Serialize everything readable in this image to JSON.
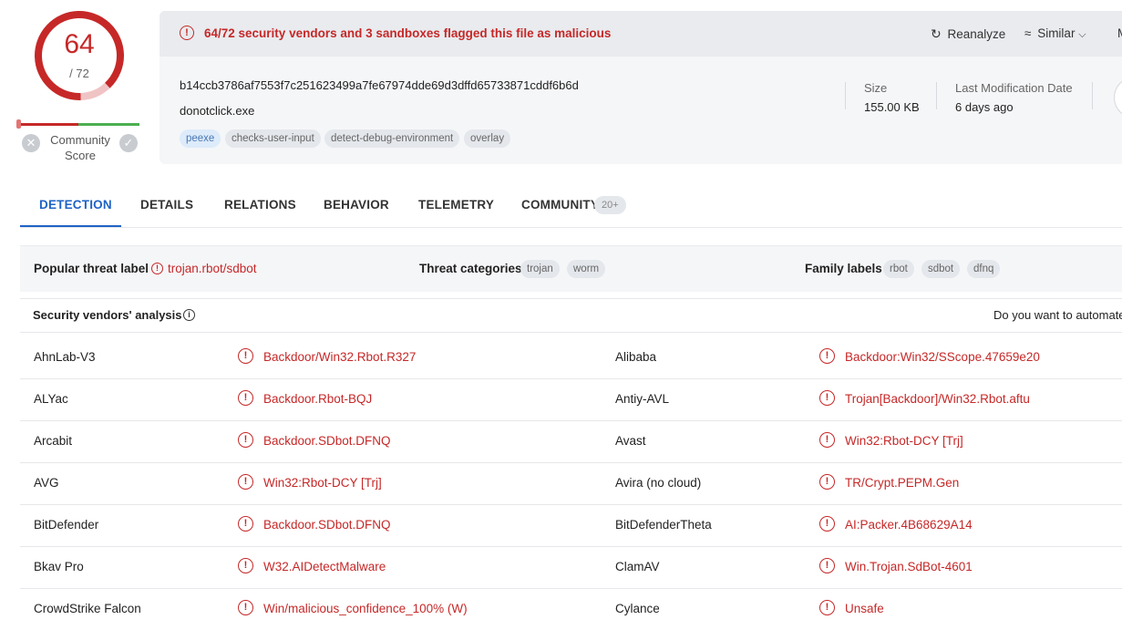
{
  "score": {
    "detections": "64",
    "total": "/ 72",
    "community_label_1": "Community",
    "community_label_2": "Score"
  },
  "alert": {
    "text": "64/72 security vendors and 3 sandboxes flagged this file as malicious"
  },
  "actions": {
    "reanalyze": "Reanalyze",
    "similar": "Similar",
    "more": "M"
  },
  "file": {
    "hash": "b14ccb3786af7553f7c251623499a7fe67974dde69d3dffd65733871cddf6b6d",
    "name": "donotclick.exe",
    "tags": [
      "peexe",
      "checks-user-input",
      "detect-debug-environment",
      "overlay"
    ]
  },
  "meta": {
    "size_label": "Size",
    "size_value": "155.00 KB",
    "mod_label": "Last Modification Date",
    "mod_value": "6 days ago"
  },
  "tabs": [
    "DETECTION",
    "DETAILS",
    "RELATIONS",
    "BEHAVIOR",
    "TELEMETRY",
    "COMMUNITY"
  ],
  "community_badge": "20+",
  "threat": {
    "popular_label": "Popular threat label",
    "popular_value": "trojan.rbot/sdbot",
    "categories_label": "Threat categories",
    "categories": [
      "trojan",
      "worm"
    ],
    "family_label": "Family labels",
    "families": [
      "rbot",
      "sdbot",
      "dfnq"
    ]
  },
  "analysis": {
    "title": "Security vendors' analysis",
    "automate_text": "Do you want to automate"
  },
  "vendors": [
    {
      "left": "AhnLab-V3",
      "left_result": "Backdoor/Win32.Rbot.R327",
      "right": "Alibaba",
      "right_result": "Backdoor:Win32/SScope.47659e20"
    },
    {
      "left": "ALYac",
      "left_result": "Backdoor.Rbot-BQJ",
      "right": "Antiy-AVL",
      "right_result": "Trojan[Backdoor]/Win32.Rbot.aftu"
    },
    {
      "left": "Arcabit",
      "left_result": "Backdoor.SDbot.DFNQ",
      "right": "Avast",
      "right_result": "Win32:Rbot-DCY [Trj]"
    },
    {
      "left": "AVG",
      "left_result": "Win32:Rbot-DCY [Trj]",
      "right": "Avira (no cloud)",
      "right_result": "TR/Crypt.PEPM.Gen"
    },
    {
      "left": "BitDefender",
      "left_result": "Backdoor.SDbot.DFNQ",
      "right": "BitDefenderTheta",
      "right_result": "AI:Packer.4B68629A14"
    },
    {
      "left": "Bkav Pro",
      "left_result": "W32.AIDetectMalware",
      "right": "ClamAV",
      "right_result": "Win.Trojan.SdBot-4601"
    },
    {
      "left": "CrowdStrike Falcon",
      "left_result": "Win/malicious_confidence_100% (W)",
      "right": "Cylance",
      "right_result": "Unsafe"
    }
  ],
  "colors": {
    "malicious": "#c62828",
    "accent": "#1f63c6",
    "community_good": "#4caf50"
  },
  "icons": [
    "alert-icon",
    "reanalyze-icon",
    "similar-icon",
    "chevron-down-icon",
    "info-icon",
    "detection-alert-icon",
    "vote-x-icon",
    "vote-check-icon"
  ]
}
